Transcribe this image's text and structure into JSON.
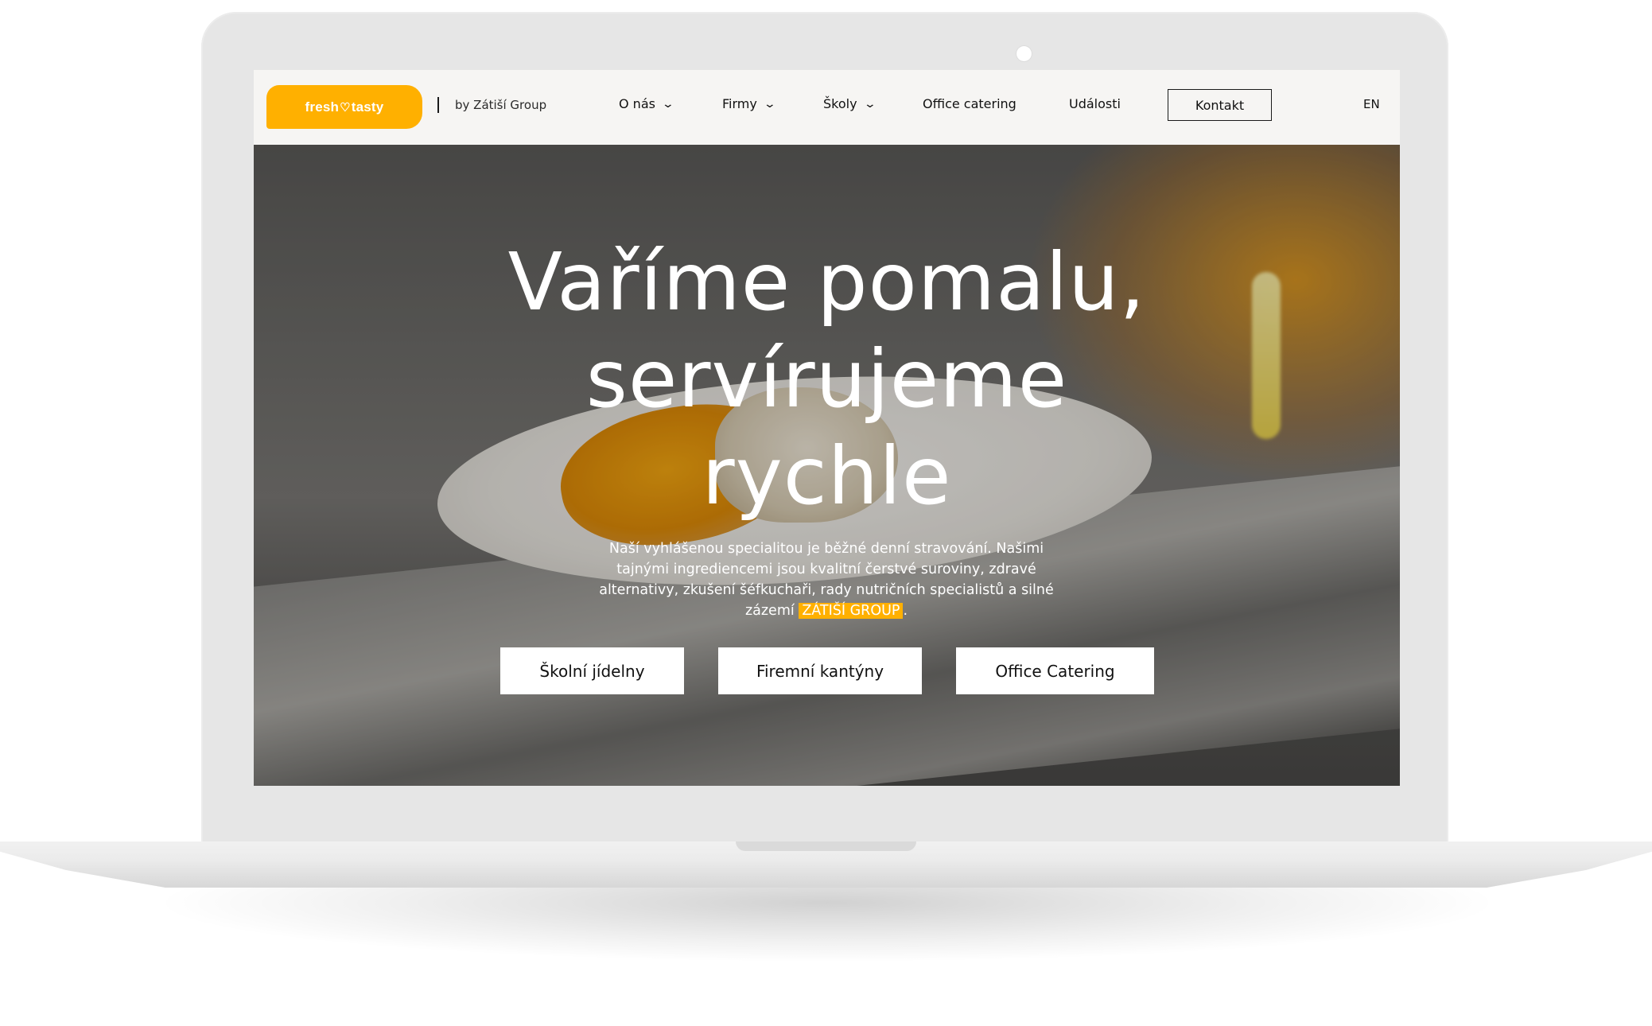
{
  "logo": {
    "left": "fresh",
    "heart": "♡",
    "right": "tasty"
  },
  "byline": "by Zátiší Group",
  "nav": {
    "items": [
      {
        "label": "O nás",
        "dropdown": true
      },
      {
        "label": "Firmy",
        "dropdown": true
      },
      {
        "label": "Školy",
        "dropdown": true
      },
      {
        "label": "Office catering",
        "dropdown": false
      },
      {
        "label": "Události",
        "dropdown": false
      }
    ],
    "contact": "Kontakt",
    "lang": "EN",
    "chevron": "⌄"
  },
  "hero": {
    "title_lines": [
      "Vaříme pomalu,",
      "servírujeme",
      "rychle"
    ],
    "description": "Naší vyhlášenou specialitou je běžné denní stravování. Našimi tajnými ingrediencemi jsou kvalitní čerstvé suroviny, zdravé alternativy, zkušení šéfkuchaři, rady nutričních specialistů a silné zázemí",
    "highlight": "ZÁTIŠÍ GROUP",
    "end": ".",
    "buttons": [
      "Školní jídelny",
      "Firemní kantýny",
      "Office Catering"
    ]
  },
  "colors": {
    "accent": "#ffb000",
    "nav_bg": "#f6f5f3",
    "text": "#111111"
  }
}
